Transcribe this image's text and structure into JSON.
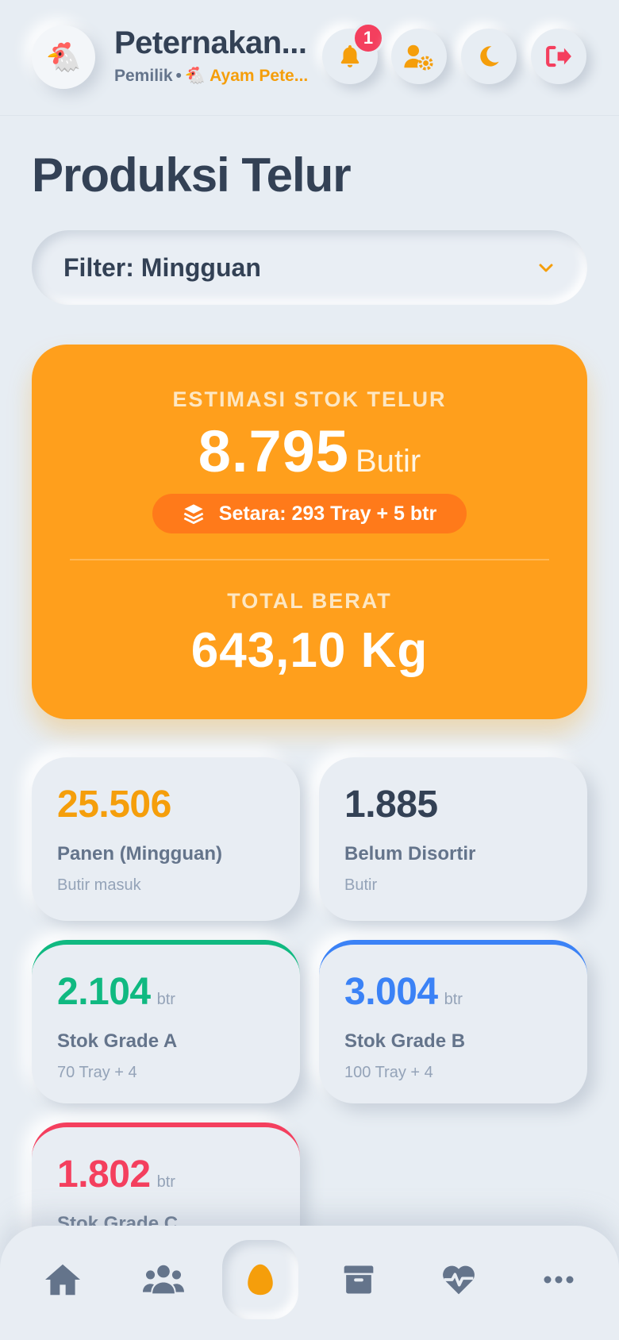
{
  "header": {
    "farm_name": "Peternakan...",
    "role": "Pemilik",
    "separator": "•",
    "farm_type_emoji": "🐔",
    "farm_type": "Ayam Pete...",
    "logo_emoji": "🐔",
    "notification_count": "1",
    "icons": [
      "bell-icon",
      "user-gear-icon",
      "moon-icon",
      "logout-icon"
    ]
  },
  "page": {
    "title": "Produksi Telur"
  },
  "filter": {
    "label": "Filter: Mingguan"
  },
  "summary": {
    "stock_label": "ESTIMASI STOK TELUR",
    "stock_value": "8.795",
    "stock_unit": "Butir",
    "tray_equivalent": "Setara: 293 Tray + 5 btr",
    "weight_label": "TOTAL BERAT",
    "weight_value": "643,10 Kg"
  },
  "stats": [
    {
      "value": "25.506",
      "unit": "",
      "title": "Panen (Mingguan)",
      "sub": "Butir masuk",
      "color": "#f59e0b"
    },
    {
      "value": "1.885",
      "unit": "",
      "title": "Belum Disortir",
      "sub": "Butir",
      "color": "#334155"
    },
    {
      "value": "2.104",
      "unit": "btr",
      "title": "Stok Grade A",
      "sub": "70 Tray + 4",
      "color": "#10b981"
    },
    {
      "value": "3.004",
      "unit": "btr",
      "title": "Stok Grade B",
      "sub": "100 Tray + 4",
      "color": "#3b82f6"
    },
    {
      "value": "1.802",
      "unit": "btr",
      "title": "Stok Grade C",
      "sub": "",
      "color": "#f43f5e"
    }
  ],
  "colors": {
    "accent": "#ff9f1c",
    "background": "#e7edf3",
    "grade_a": "#10b981",
    "grade_b": "#3b82f6",
    "grade_c": "#f43f5e",
    "badge": "#f43f5e"
  },
  "nav": {
    "items": [
      "home-icon",
      "users-icon",
      "egg-icon",
      "box-icon",
      "heart-pulse-icon",
      "more-icon"
    ],
    "active": "egg-icon"
  }
}
